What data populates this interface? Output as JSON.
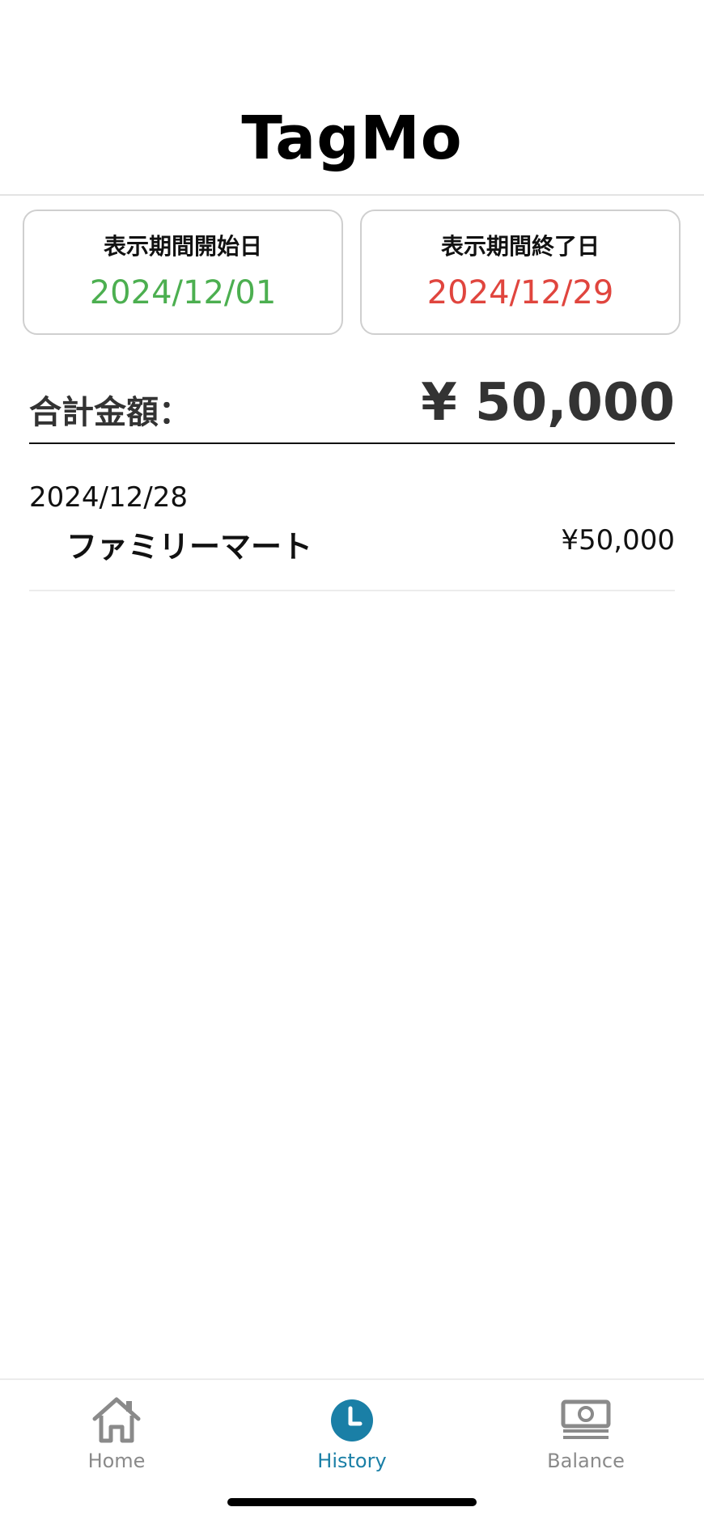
{
  "app": {
    "title": "TagMo"
  },
  "period": {
    "start": {
      "label": "表示期間開始日",
      "value": "2024/12/01",
      "color": "#4caf50"
    },
    "end": {
      "label": "表示期間終了日",
      "value": "2024/12/29",
      "color": "#e0453e"
    }
  },
  "total": {
    "label": "合計金額：",
    "amount": "¥ 50,000"
  },
  "transactions": [
    {
      "date": "2024/12/28",
      "merchant": "ファミリーマート",
      "amount": "¥50,000"
    }
  ],
  "tabs": [
    {
      "label": "Home",
      "icon": "house-icon",
      "active": false
    },
    {
      "label": "History",
      "icon": "clock-icon",
      "active": true
    },
    {
      "label": "Balance",
      "icon": "banknote-icon",
      "active": false
    }
  ],
  "colors": {
    "accent": "#1a7fa6",
    "inactive": "#8a8a8a"
  }
}
